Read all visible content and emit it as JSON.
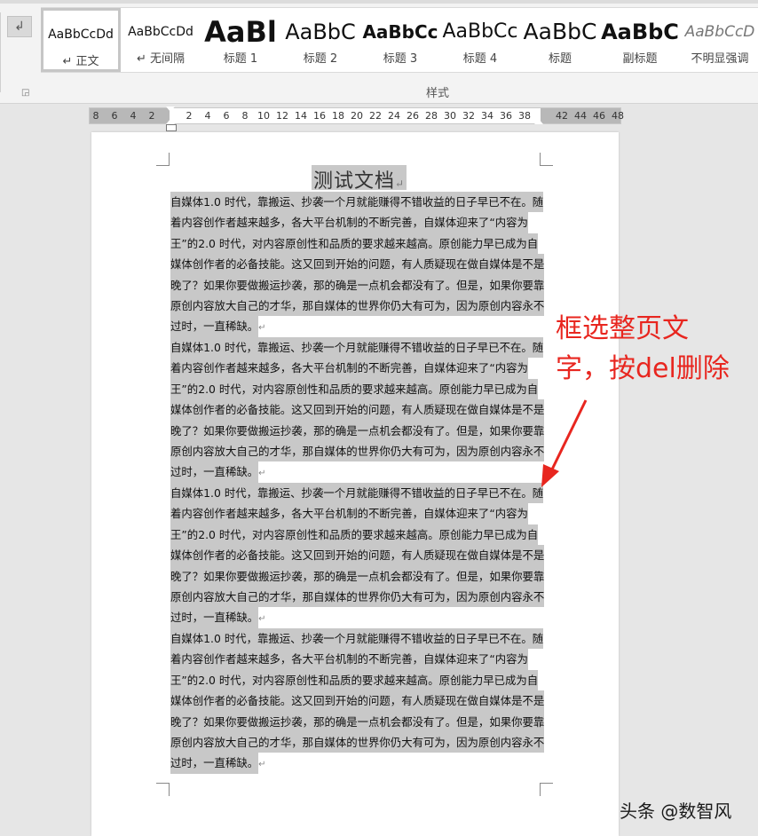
{
  "ribbon": {
    "group_label": "样式",
    "launcher_icon": "dialog-launcher-icon",
    "left_icon": "format-painter-icon",
    "styles": [
      {
        "preview": "AaBbCcDd",
        "name": "↵ 正文",
        "preview_size": "14px",
        "weight": "normal",
        "italic": false,
        "selected": true
      },
      {
        "preview": "AaBbCcDd",
        "name": "↵ 无间隔",
        "preview_size": "14px",
        "weight": "normal",
        "italic": false,
        "selected": false
      },
      {
        "preview": "AaBl",
        "name": "标题 1",
        "preview_size": "32px",
        "weight": "bold",
        "italic": false,
        "selected": false
      },
      {
        "preview": "AaBbC",
        "name": "标题 2",
        "preview_size": "24px",
        "weight": "normal",
        "italic": false,
        "selected": false
      },
      {
        "preview": "AaBbCc",
        "name": "标题 3",
        "preview_size": "20px",
        "weight": "bold",
        "italic": false,
        "selected": false
      },
      {
        "preview": "AaBbCc",
        "name": "标题 4",
        "preview_size": "22px",
        "weight": "normal",
        "italic": false,
        "selected": false
      },
      {
        "preview": "AaBbC",
        "name": "标题",
        "preview_size": "25px",
        "weight": "normal",
        "italic": false,
        "selected": false
      },
      {
        "preview": "AaBbC",
        "name": "副标题",
        "preview_size": "24px",
        "weight": "bold",
        "italic": false,
        "selected": false
      },
      {
        "preview": "AaBbCcD",
        "name": "不明显强调",
        "preview_size": "17px",
        "weight": "normal",
        "italic": true,
        "selected": false
      }
    ]
  },
  "ruler": {
    "numbers": [
      "8",
      "6",
      "4",
      "2",
      "2",
      "4",
      "6",
      "8",
      "10",
      "12",
      "14",
      "16",
      "18",
      "20",
      "22",
      "24",
      "26",
      "28",
      "30",
      "32",
      "34",
      "36",
      "38",
      "42",
      "44",
      "46",
      "48"
    ]
  },
  "document": {
    "title": "测试文档",
    "paragraph_mark": "↵",
    "paragraphs": [
      {
        "lines": [
          "自媒体1.0 时代，靠搬运、抄袭一个月就能赚得不错收益的日子早已不在。随",
          "着内容创作者越来越多，各大平台机制的不断完善，自媒体迎来了“内容为",
          "王”的2.0 时代，对内容原创性和品质的要求越来越高。原创能力早已成为自",
          "媒体创作者的必备技能。这又回到开始的问题，有人质疑现在做自媒体是不是",
          "晚了？如果你要做搬运抄袭，那的确是一点机会都没有了。但是，如果你要靠",
          "原创内容放大自己的才华，那自媒体的世界你仍大有可为，因为原创内容永不",
          "过时，一直稀缺。"
        ]
      },
      {
        "lines": [
          "自媒体1.0 时代，靠搬运、抄袭一个月就能赚得不错收益的日子早已不在。随",
          "着内容创作者越来越多，各大平台机制的不断完善，自媒体迎来了“内容为",
          "王”的2.0 时代，对内容原创性和品质的要求越来越高。原创能力早已成为自",
          "媒体创作者的必备技能。这又回到开始的问题，有人质疑现在做自媒体是不是",
          "晚了？如果你要做搬运抄袭，那的确是一点机会都没有了。但是，如果你要靠",
          "原创内容放大自己的才华，那自媒体的世界你仍大有可为，因为原创内容永不",
          "过时，一直稀缺。"
        ]
      },
      {
        "lines": [
          "自媒体1.0 时代，靠搬运、抄袭一个月就能赚得不错收益的日子早已不在。随",
          "着内容创作者越来越多，各大平台机制的不断完善，自媒体迎来了“内容为",
          "王”的2.0 时代，对内容原创性和品质的要求越来越高。原创能力早已成为自",
          "媒体创作者的必备技能。这又回到开始的问题，有人质疑现在做自媒体是不是",
          "晚了？如果你要做搬运抄袭，那的确是一点机会都没有了。但是，如果你要靠",
          "原创内容放大自己的才华，那自媒体的世界你仍大有可为，因为原创内容永不",
          "过时，一直稀缺。"
        ]
      },
      {
        "lines": [
          "自媒体1.0 时代，靠搬运、抄袭一个月就能赚得不错收益的日子早已不在。随",
          "着内容创作者越来越多，各大平台机制的不断完善，自媒体迎来了“内容为",
          "王”的2.0 时代，对内容原创性和品质的要求越来越高。原创能力早已成为自",
          "媒体创作者的必备技能。这又回到开始的问题，有人质疑现在做自媒体是不是",
          "晚了？如果你要做搬运抄袭，那的确是一点机会都没有了。但是，如果你要靠",
          "原创内容放大自己的才华，那自媒体的世界你仍大有可为，因为原创内容永不",
          "过时，一直稀缺。"
        ]
      }
    ]
  },
  "annotation": {
    "line1": "框选整页文",
    "line2": "字，按del删除",
    "color": "#e8261f"
  },
  "watermark": "头条 @数智风"
}
